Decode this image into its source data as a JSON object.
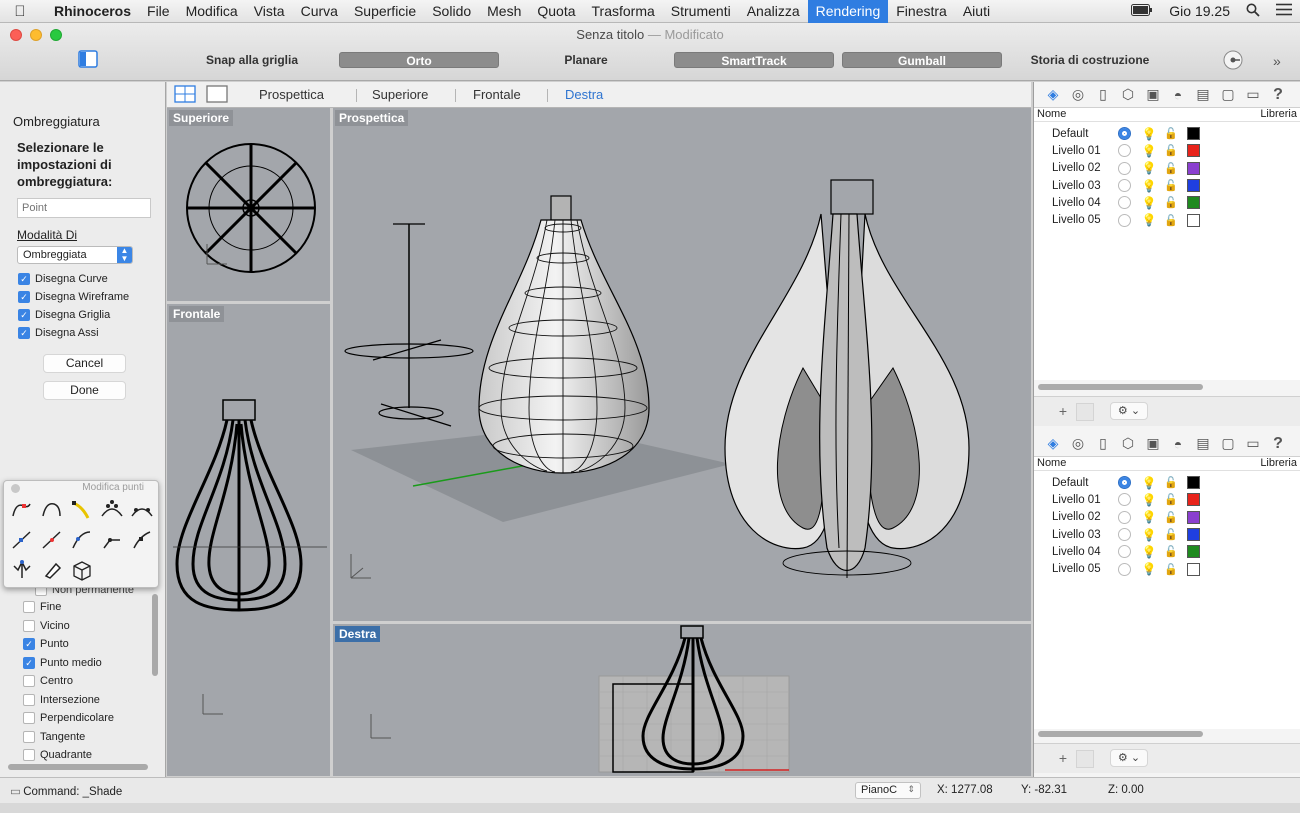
{
  "menubar": {
    "app": "Rhinoceros",
    "items": [
      "File",
      "Modifica",
      "Vista",
      "Curva",
      "Superficie",
      "Solido",
      "Mesh",
      "Quota",
      "Trasforma",
      "Strumenti",
      "Analizza",
      "Rendering",
      "Finestra",
      "Aiuti"
    ],
    "active": "Rendering",
    "clock": "Gio 19.25"
  },
  "window": {
    "title": "Senza titolo",
    "subtitle": "— Modificato"
  },
  "toolbar": {
    "snap": "Snap alla griglia",
    "orto": "Orto",
    "planare": "Planare",
    "smarttrack": "SmartTrack",
    "gumball": "Gumball",
    "history": "Storia di costruzione"
  },
  "viewport_tabs": [
    "Prospettica",
    "Superiore",
    "Frontale",
    "Destra"
  ],
  "active_viewport_tab": "Destra",
  "viewports": {
    "top": "Superiore",
    "front": "Frontale",
    "persp": "Prospettica",
    "right": "Destra"
  },
  "shade_panel": {
    "title": "Ombreggiatura",
    "prompt": "Selezionare le impostazioni di ombreggiatura:",
    "input_placeholder": "Point",
    "mode_label": "Modalità Di",
    "mode_value": "Ombreggiata",
    "checks": [
      {
        "label": "Disegna Curve",
        "checked": true
      },
      {
        "label": "Disegna Wireframe",
        "checked": true
      },
      {
        "label": "Disegna Griglia",
        "checked": true
      },
      {
        "label": "Disegna Assi",
        "checked": true
      }
    ],
    "cancel": "Cancel",
    "done": "Done"
  },
  "point_toolbar": {
    "title": "Modifica punti"
  },
  "osnap": {
    "partial": "Non permanente",
    "items": [
      {
        "label": "Fine",
        "checked": false
      },
      {
        "label": "Vicino",
        "checked": false
      },
      {
        "label": "Punto",
        "checked": true
      },
      {
        "label": "Punto medio",
        "checked": true
      },
      {
        "label": "Centro",
        "checked": false
      },
      {
        "label": "Intersezione",
        "checked": false
      },
      {
        "label": "Perpendicolare",
        "checked": false
      },
      {
        "label": "Tangente",
        "checked": false
      },
      {
        "label": "Quadrante",
        "checked": false
      }
    ]
  },
  "layers": {
    "col_name": "Nome",
    "col_library": "Libreria",
    "rows": [
      {
        "name": "Default",
        "current": true,
        "color": "#000000"
      },
      {
        "name": "Livello 01",
        "current": false,
        "color": "#e8231b"
      },
      {
        "name": "Livello 02",
        "current": false,
        "color": "#8a3fcf"
      },
      {
        "name": "Livello 03",
        "current": false,
        "color": "#1f3fe0"
      },
      {
        "name": "Livello 04",
        "current": false,
        "color": "#1f8a1f"
      },
      {
        "name": "Livello 05",
        "current": false,
        "color": "#ffffff"
      }
    ]
  },
  "statusbar": {
    "command": "Command: _Shade",
    "cplane": "PianoC",
    "x": "X: 1277.08",
    "y": "Y: -82.31",
    "z": "Z: 0.00"
  },
  "colors": {
    "accent": "#2f7de1",
    "viewport_bg": "#a3a6ab"
  }
}
